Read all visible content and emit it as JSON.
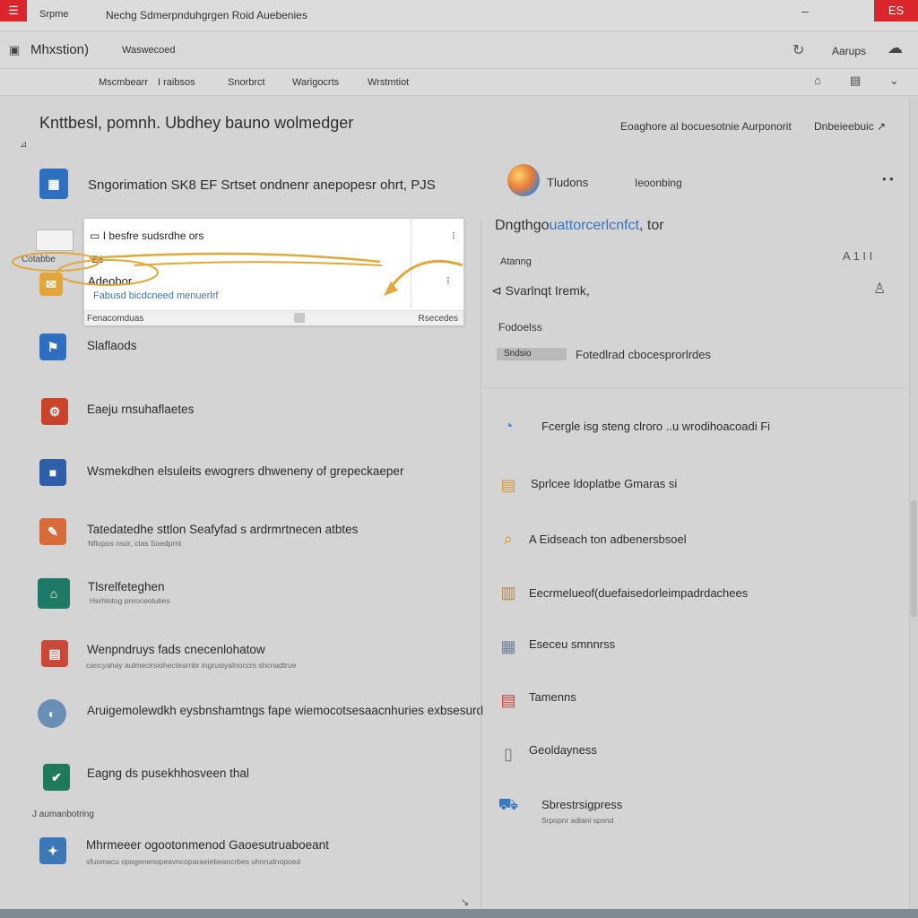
{
  "window": {
    "menu_glyph": "☰",
    "tab_label": "Srpme",
    "title": "Nechg Sdmerpnduhgrgen Roid Auebenies",
    "minimize_glyph": "–",
    "close_label": "ES"
  },
  "appbar": {
    "app_icon": "▣",
    "name": "Mhxstion)",
    "sub": "Waswecoed",
    "refresh_glyph": "↻",
    "action": "Aarups",
    "cloud_glyph": "☁"
  },
  "nav": {
    "items": [
      "Mscmbearr",
      "I raibsos",
      "Snorbrct",
      "Warigocrts",
      "Wrstmtiot"
    ],
    "icons": [
      "⌂",
      "▤",
      "⌄"
    ]
  },
  "page": {
    "title": "Knttbesl, pomnh. Ubdhey bauno wolmedger",
    "back_glyph": "⊿",
    "top_link": "Eoaghore al bocuesotnie Aurponorit",
    "top_link2": "Dnbeieebuic ↗"
  },
  "left_items": [
    {
      "glyph": "▦",
      "color": "#2f6fc0",
      "title": "Sngorimation SK8 EF Srtset ondnenr anepopesr ohrt, PJS",
      "sub": ""
    },
    {
      "glyph": "",
      "color": "",
      "title": "",
      "sub": ""
    },
    {
      "glyph": "✉",
      "color": "#e1a53a",
      "title": "",
      "sub": ""
    },
    {
      "glyph": "⚑",
      "color": "#2f6fc0",
      "title": "Slaflaods",
      "sub": ""
    },
    {
      "glyph": "⚙",
      "color": "#c8452c",
      "title": "Eaeju rnsuhaflaetes",
      "sub": ""
    },
    {
      "glyph": "■",
      "color": "#2f5fa8",
      "title": "Wsmekdhen elsuleits ewogrers dhweneny of grepeckaeper",
      "sub": ""
    },
    {
      "glyph": "✎",
      "color": "#d86b3a",
      "title": "Tatedatedhe sttlon Seafyfad s ardrmrtnecen atbtes",
      "sub": "Nflopos nsor, ctas Soedprnt"
    },
    {
      "glyph": "⌂",
      "color": "#1e7a66",
      "title": "Tlsrelfeteghen",
      "sub": "Hsrhlotog pnroceolubes"
    },
    {
      "glyph": "▤",
      "color": "#c9483a",
      "title": "Wenpndruys fads cnecenlohatow",
      "sub": "cancyahay aulmeclrsiohectearnbr ingrusiyalnoccrs shcnadtrue"
    },
    {
      "glyph": "◐",
      "color": "#6a8fb5",
      "title": "Aruigemolewdkh eysbnshamtngs fape wiemocotsesaacnhuries exbsesurd",
      "sub": ""
    },
    {
      "glyph": "✔",
      "color": "#1e7a5a",
      "title": "Eagng ds pusekhhosveen thal",
      "sub": ""
    },
    {
      "glyph": "✦",
      "color": "#3a78b8",
      "title": "Mhrmeeer ogootonmenod Gaoesutruaboeant",
      "sub": "sfuomacu opogenenopeavncoparaeiebeaocrbes uhnrudnopoed"
    }
  ],
  "section_tiny": "J aumanbotring",
  "highlight": {
    "title_prefix": "▭",
    "title": "I besfre sudsrdhe ors",
    "line2": "E6",
    "line3": "Adeobor",
    "link": "Fabusd bicdcneed menuerlrf",
    "kebab": "⁝",
    "bottom_left": "Fenacomduas",
    "bottom_right": "Rsecedes",
    "left_tab": "Cotabbe"
  },
  "right": {
    "orb_label": "Tludons",
    "mid": "Ieoonbing",
    "dots": "• •",
    "heading_prefix": "Dngthgo",
    "heading_link": "uattorcerlcnfct",
    "heading_suffix": ", tor",
    "label": "Atanng",
    "counter": "A 1 I I",
    "sub_prefix": "⊲",
    "sub": "Svarlnqt Iremk,",
    "bell": "♙",
    "section": "Fodoelss",
    "chip": "Sndsio",
    "chip_text": "Fotedlrad cbocesprorlrdes",
    "items": [
      {
        "glyph": "◔",
        "color": "#3b8fd6",
        "label": "Fcergle isg steng clroro ..u wrodihoacoadi Fi"
      },
      {
        "glyph": "▤",
        "color": "#d99a40",
        "label": "Sprlcee ldoplatbe Gmaras si"
      },
      {
        "glyph": "⌕",
        "color": "#d89a23",
        "label": "A Eidseach ton adbenersbsoel"
      },
      {
        "glyph": "▥",
        "color": "#b08a50",
        "label": "Eecrmelueof(duefaisedorleimpadrdachees"
      },
      {
        "glyph": "▦",
        "color": "#6e7f99",
        "label": "Eseceu smnnrss"
      },
      {
        "glyph": "▤",
        "color": "#c9403a",
        "label": "Tamenns"
      },
      {
        "glyph": "▯",
        "color": "#777777",
        "label": "Geoldayness"
      },
      {
        "glyph": "⛟",
        "color": "#3c78c0",
        "label": "Sbrestrsigpress"
      }
    ],
    "last_sub": "Srpopnr adlanl spsnd"
  },
  "colors": {
    "accent_red": "#d9252b",
    "highlight_orange": "#e0a838",
    "link_blue": "#3b73b9"
  },
  "corner_glyph": "↘"
}
